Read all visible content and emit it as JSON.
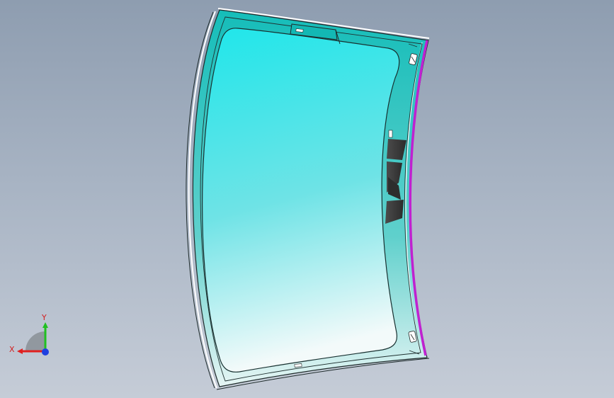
{
  "viewport": {
    "background_top": "#8e9db0",
    "background_bottom": "#c5ccd7"
  },
  "model": {
    "glass_color_top": "#22e6ea",
    "glass_color_bottom": "#eef8f8",
    "frame_color": "#18c4c0",
    "edge_color": "#c021d0",
    "band_color": "#3a3a3a"
  },
  "triad": {
    "x_label": "X",
    "y_label": "Y",
    "x_color": "#e02020",
    "y_color": "#20c020",
    "z_color": "#2040e0"
  }
}
